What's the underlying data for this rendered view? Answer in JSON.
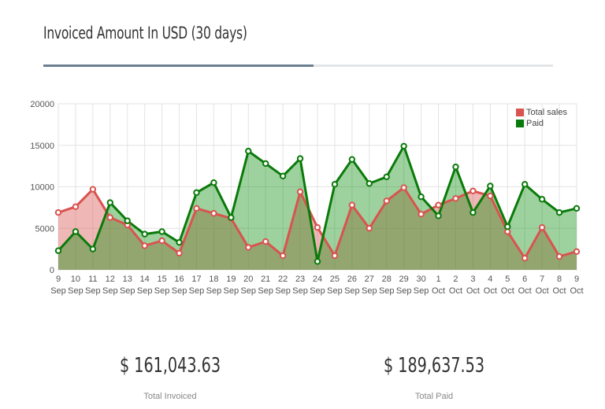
{
  "title": "Invoiced Amount In USD (30 days)",
  "stats": {
    "invoiced_value": "$ 161,043.63",
    "invoiced_label": "Total Invoiced",
    "paid_value": "$ 189,637.53",
    "paid_label": "Total Paid"
  },
  "colors": {
    "total_sales": "#d9534f",
    "paid": "#0a7a0a",
    "accent": "#6b7f91"
  },
  "chart_data": {
    "type": "area",
    "title": "",
    "xlabel": "",
    "ylabel": "",
    "ylim": [
      0,
      20000
    ],
    "yticks": [
      0,
      5000,
      10000,
      15000,
      20000
    ],
    "grid": true,
    "legend_position": "top-right",
    "categories": [
      [
        "9",
        "Sep"
      ],
      [
        "10",
        "Sep"
      ],
      [
        "11",
        "Sep"
      ],
      [
        "12",
        "Sep"
      ],
      [
        "13",
        "Sep"
      ],
      [
        "14",
        "Sep"
      ],
      [
        "15",
        "Sep"
      ],
      [
        "16",
        "Sep"
      ],
      [
        "17",
        "Sep"
      ],
      [
        "18",
        "Sep"
      ],
      [
        "19",
        "Sep"
      ],
      [
        "20",
        "Sep"
      ],
      [
        "21",
        "Sep"
      ],
      [
        "22",
        "Sep"
      ],
      [
        "23",
        "Sep"
      ],
      [
        "24",
        "Sep"
      ],
      [
        "25",
        "Sep"
      ],
      [
        "26",
        "Sep"
      ],
      [
        "27",
        "Sep"
      ],
      [
        "28",
        "Sep"
      ],
      [
        "29",
        "Sep"
      ],
      [
        "30",
        "Sep"
      ],
      [
        "1",
        "Oct"
      ],
      [
        "2",
        "Oct"
      ],
      [
        "3",
        "Oct"
      ],
      [
        "4",
        "Oct"
      ],
      [
        "5",
        "Oct"
      ],
      [
        "6",
        "Oct"
      ],
      [
        "7",
        "Oct"
      ],
      [
        "8",
        "Oct"
      ],
      [
        "9",
        "Oct"
      ]
    ],
    "series": [
      {
        "name": "Total sales",
        "values": [
          6900,
          7600,
          9700,
          6300,
          5400,
          2900,
          3500,
          2000,
          7400,
          6800,
          6200,
          2700,
          3400,
          1700,
          9400,
          5100,
          1700,
          7800,
          5000,
          8300,
          9900,
          6700,
          7800,
          8600,
          9500,
          8900,
          4600,
          1400,
          5100,
          1600,
          2200
        ]
      },
      {
        "name": "Paid",
        "values": [
          2300,
          4600,
          2500,
          8100,
          5900,
          4300,
          4600,
          3300,
          9300,
          10500,
          6300,
          14300,
          12800,
          11300,
          13400,
          1000,
          10300,
          13300,
          10400,
          11200,
          14900,
          8800,
          6500,
          12400,
          6900,
          10100,
          5200,
          10300,
          8500,
          6900,
          7400
        ]
      }
    ]
  }
}
